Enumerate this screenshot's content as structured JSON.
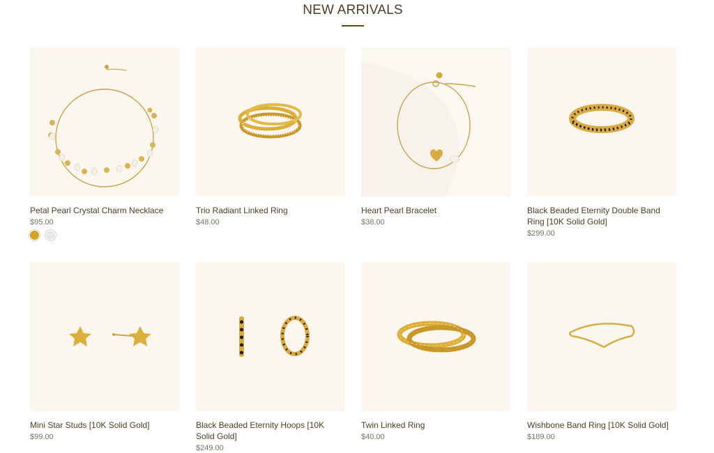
{
  "section": {
    "title": "NEW ARRIVALS"
  },
  "colors": {
    "gold": "#d4a320",
    "silver": "#e8e8e8",
    "image_bg": "#fbf7ef",
    "text": "#4a3f22"
  },
  "products": [
    {
      "name": "Petal Pearl Crystal Charm Necklace",
      "price": "$95.00",
      "image": "gold-pearl-charm-necklace",
      "swatches": [
        "gold",
        "silver"
      ]
    },
    {
      "name": "Trio Radiant Linked Ring",
      "price": "$48.00",
      "image": "triple-linked-gold-ring"
    },
    {
      "name": "Heart Pearl Bracelet",
      "price": "$38.00",
      "image": "gold-heart-pearl-bracelet"
    },
    {
      "name": "Black Beaded Eternity Double Band Ring [10K Solid Gold]",
      "price": "$299.00",
      "image": "black-beaded-double-band-ring"
    },
    {
      "name": "Mini Star Studs [10K Solid Gold]",
      "price": "$99.00",
      "image": "gold-star-stud-earrings"
    },
    {
      "name": "Black Beaded Eternity Hoops [10K Solid Gold]",
      "price": "$249.00",
      "image": "black-beaded-hoop-earrings"
    },
    {
      "name": "Twin Linked Ring",
      "price": "$40.00",
      "image": "twin-linked-gold-ring"
    },
    {
      "name": "Wishbone Band Ring [10K Solid Gold]",
      "price": "$189.00",
      "image": "gold-wishbone-ring"
    }
  ]
}
